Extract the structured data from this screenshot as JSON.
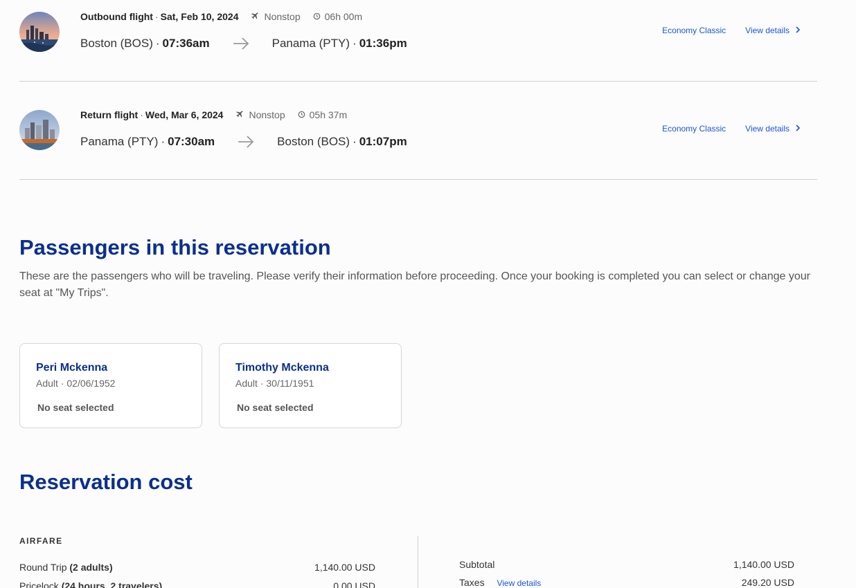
{
  "flights": [
    {
      "type_label": "Outbound flight",
      "date": "Sat, Feb 10, 2024",
      "stops": "Nonstop",
      "duration": "06h 00m",
      "origin": "Boston (BOS)",
      "depart_time": "07:36am",
      "destination": "Panama (PTY)",
      "arrive_time": "01:36pm",
      "cabin": "Economy Classic",
      "details_label": "View details"
    },
    {
      "type_label": "Return flight",
      "date": "Wed, Mar 6, 2024",
      "stops": "Nonstop",
      "duration": "05h 37m",
      "origin": "Panama (PTY)",
      "depart_time": "07:30am",
      "destination": "Boston (BOS)",
      "arrive_time": "01:07pm",
      "cabin": "Economy Classic",
      "details_label": "View details"
    }
  ],
  "passengers_section": {
    "title": "Passengers in this reservation",
    "description": "These are the passengers who will be traveling. Please verify their information before proceeding. Once your booking is completed you can select or change your seat at \"My Trips\".",
    "passengers": [
      {
        "name": "Peri Mckenna",
        "type": "Adult",
        "dob": "02/06/1952",
        "seat": "No seat selected"
      },
      {
        "name": "Timothy Mckenna",
        "type": "Adult",
        "dob": "30/11/1951",
        "seat": "No seat selected"
      }
    ]
  },
  "cost_section": {
    "title": "Reservation cost",
    "airfare_label": "AIRFARE",
    "round_trip_label": "Round Trip",
    "round_trip_qty": "(2 adults)",
    "round_trip_amount": "1,140.00 USD",
    "pricelock_label": "Pricelock",
    "pricelock_qty": "(24 hours, 2 travelers)",
    "pricelock_amount": "0.00 USD",
    "subtotal_label": "Subtotal",
    "subtotal_amount": "1,140.00 USD",
    "taxes_label": "Taxes",
    "taxes_link": "View details",
    "taxes_amount": "249.20 USD"
  },
  "colors": {
    "brand_blue": "#0b2f8f",
    "link_blue": "#1a56d6",
    "background": "#fcfcfc"
  },
  "icons": [
    "plane-icon",
    "clock-icon",
    "arrow-right-icon",
    "chevron-right-icon"
  ]
}
